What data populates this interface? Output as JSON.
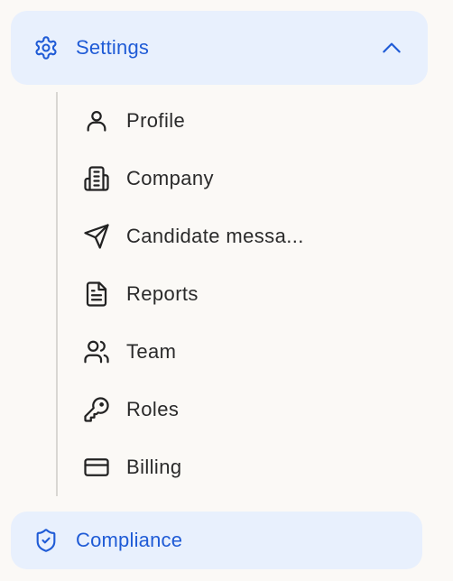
{
  "settings": {
    "label": "Settings",
    "icon": "gear-icon",
    "expanded_icon": "chevron-up-icon",
    "color": "#1f5bd6",
    "background": "#e8f0fd"
  },
  "submenu": {
    "items": [
      {
        "label": "Profile",
        "icon": "user-icon"
      },
      {
        "label": "Company",
        "icon": "building-icon"
      },
      {
        "label": "Candidate messa...",
        "icon": "send-icon"
      },
      {
        "label": "Reports",
        "icon": "document-icon"
      },
      {
        "label": "Team",
        "icon": "users-icon"
      },
      {
        "label": "Roles",
        "icon": "key-icon"
      },
      {
        "label": "Billing",
        "icon": "credit-card-icon"
      }
    ]
  },
  "compliance": {
    "label": "Compliance",
    "icon": "shield-check-icon"
  }
}
